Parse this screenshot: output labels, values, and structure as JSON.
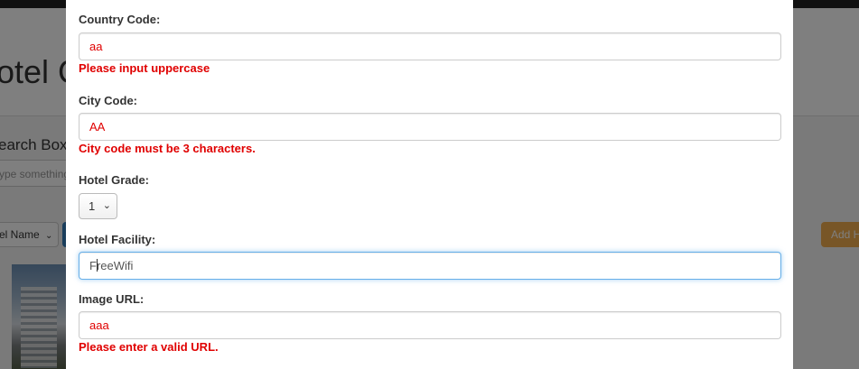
{
  "background": {
    "title": "otel C",
    "search_label": "earch Box",
    "search_placeholder": "ype something",
    "select_value": "el Name",
    "add_button_label": "Add H"
  },
  "form": {
    "country_code": {
      "label": "Country Code:",
      "value": "aa",
      "error": "Please input uppercase"
    },
    "city_code": {
      "label": "City Code:",
      "value": "AA",
      "error": "City code must be 3 characters."
    },
    "hotel_grade": {
      "label": "Hotel Grade:",
      "value": "1"
    },
    "hotel_facility": {
      "label": "Hotel Facility:",
      "value_before_caret": "F",
      "value_after_caret": "reeWifi"
    },
    "image_url": {
      "label": "Image URL:",
      "value": "aaa",
      "error": "Please enter a valid URL."
    }
  },
  "colors": {
    "error": "#e00000",
    "focus_border": "#66afe9",
    "add_button": "#f0ad4e",
    "primary_button": "#337ab7"
  },
  "icons": {
    "chevron": "chevron-down-icon"
  }
}
